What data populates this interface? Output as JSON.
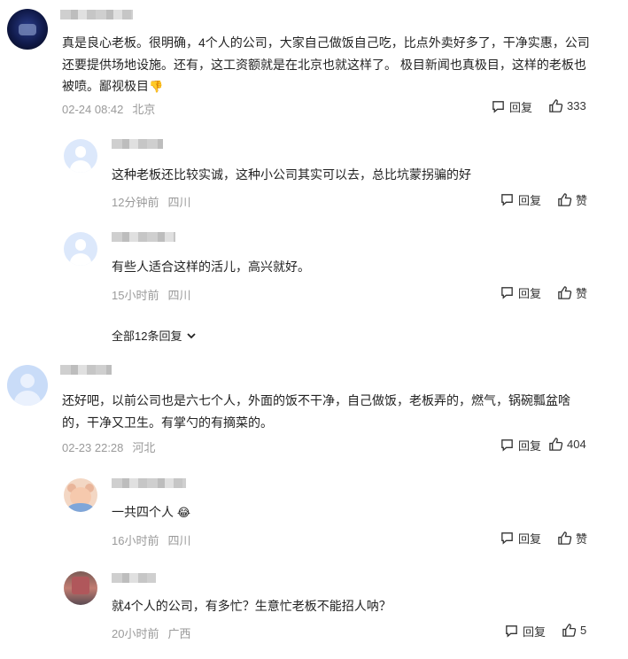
{
  "comments": [
    {
      "text": "真是良心老板。很明确，4个人的公司，大家自己做饭自己吃，比点外卖好多了，干净实惠，公司还要提供场地设施。还有，这工资额就是在北京也就这样了。 极目新闻也真极目，这样的老板也被喷。鄙视极目",
      "emoji": "👎",
      "time": "02-24 08:42",
      "location": "北京",
      "reply_label": "回复",
      "likes": "333",
      "replies": [
        {
          "text": "这种老板还比较实诚，这种小公司其实可以去，总比坑蒙拐骗的好",
          "time": "12分钟前",
          "location": "四川",
          "reply_label": "回复",
          "like_label": "赞"
        },
        {
          "text": "有些人适合这样的活儿，高兴就好。",
          "time": "15小时前",
          "location": "四川",
          "reply_label": "回复",
          "like_label": "赞"
        }
      ],
      "more_replies": "全部12条回复"
    },
    {
      "text": "还好吧，以前公司也是六七个人，外面的饭不干净，自己做饭，老板弄的，燃气，锅碗瓢盆啥的，干净又卫生。有掌勺的有摘菜的。",
      "time": "02-23 22:28",
      "location": "河北",
      "reply_label": "回复",
      "likes": "404",
      "replies": [
        {
          "text": "一共四个人",
          "emoji": "😂",
          "time": "16小时前",
          "location": "四川",
          "reply_label": "回复",
          "like_label": "赞"
        },
        {
          "text": "就4个人的公司，有多忙？生意忙老板不能招人呐？",
          "time": "20小时前",
          "location": "广西",
          "reply_label": "回复",
          "likes": "5"
        }
      ]
    }
  ]
}
